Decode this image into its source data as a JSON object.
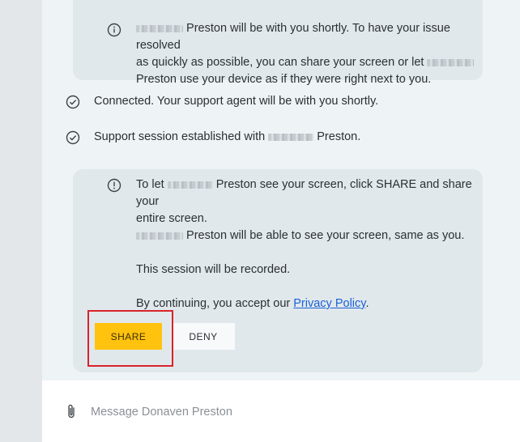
{
  "conversation": {
    "agent_last_name": "Preston",
    "info_message": {
      "icon": "info-circle-icon",
      "line1_suffix": "Preston will be with you shortly. To have your issue resolved",
      "line2_prefix": "as quickly as possible, you can share your screen or let",
      "line3": "Preston use your device as if they were right next to you."
    },
    "status_messages": [
      {
        "icon": "check-circle-icon",
        "text": "Connected. Your support agent will be with you shortly."
      },
      {
        "icon": "check-circle-icon",
        "prefix": "Support session established with",
        "suffix": "Preston."
      }
    ],
    "share_request": {
      "icon": "alert-circle-icon",
      "line1_prefix": "To let",
      "line1_suffix": "Preston see your screen, click SHARE and share your",
      "line2": "entire screen.",
      "line3_suffix": "Preston will be able to see your screen, same as you.",
      "recorded_notice": "This session will be recorded.",
      "consent_prefix": "By continuing, you accept our",
      "privacy_link": "Privacy Policy",
      "consent_suffix": ".",
      "share_label": "SHARE",
      "deny_label": "DENY"
    }
  },
  "composer": {
    "placeholder": "Message Donaven Preston",
    "value": ""
  },
  "colors": {
    "share_button": "#ffc20e",
    "highlight_border": "#d9232b",
    "link": "#1a62d6",
    "bubble": "#e1e8ec",
    "chat_background": "#eef3f6"
  }
}
